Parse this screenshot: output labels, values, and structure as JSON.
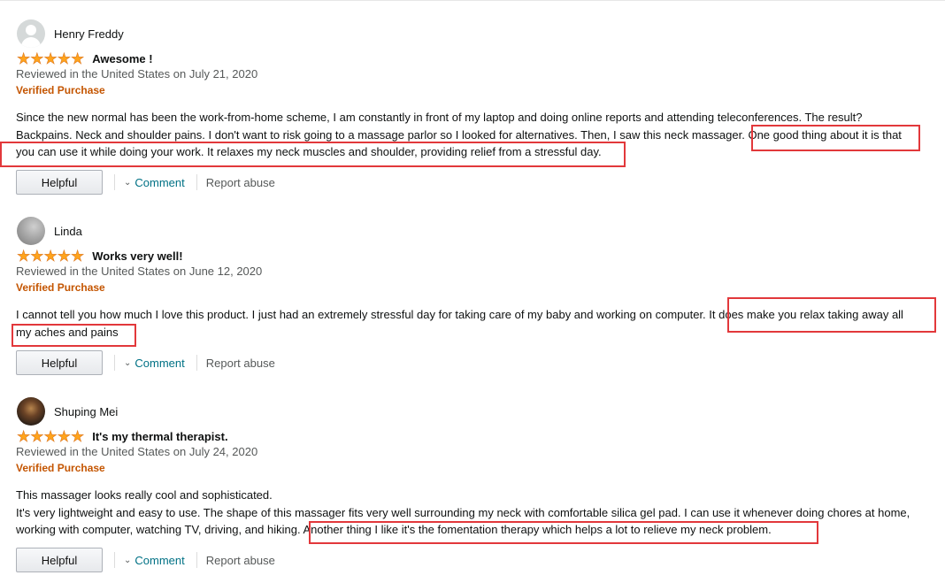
{
  "reviews": [
    {
      "name": "Henry Freddy",
      "avatar_icon": "default-profile-icon",
      "stars": "★★★★★",
      "title": "Awesome !",
      "date": "Reviewed in the United States on July 21, 2020",
      "verified": "Verified Purchase",
      "lines": [
        "Since the new normal has been the work-from-home scheme, I am constantly in front of my laptop and doing online reports and attending teleconferences. The result?",
        "Backpains. Neck and shoulder pains. I don't want to risk going to a massage parlor so I looked for alternatives. Then, I saw this neck massager. One good thing about it is that",
        "you can use it while doing your work. It relaxes my neck muscles and shoulder, providing relief from a stressful day."
      ],
      "helpful": "Helpful",
      "comment": "Comment",
      "report": "Report abuse"
    },
    {
      "name": "Linda",
      "avatar_icon": "profile-photo",
      "stars": "★★★★★",
      "title": "Works very well!",
      "date": "Reviewed in the United States on June 12, 2020",
      "verified": "Verified Purchase",
      "lines": [
        "I cannot tell you how much I love this product. I just had an extremely stressful day for taking care of my baby and working on computer. It does make you relax taking away all",
        "my aches and pains"
      ],
      "helpful": "Helpful",
      "comment": "Comment",
      "report": "Report abuse"
    },
    {
      "name": "Shuping Mei",
      "avatar_icon": "profile-photo",
      "stars": "★★★★★",
      "title": "It's my thermal therapist.",
      "date": "Reviewed in the United States on July 24, 2020",
      "verified": "Verified Purchase",
      "lines": [
        "This massager looks really cool and sophisticated.",
        "It's very lightweight and easy to use. The shape of this massager fits very well surrounding my neck with comfortable silica gel pad. I can use it whenever doing chores at home,",
        "working with computer, watching TV, driving, and hiking. Another thing I like it's the fomentation therapy which helps a lot to relieve my neck problem."
      ],
      "helpful": "Helpful",
      "comment": "Comment",
      "report": "Report abuse"
    }
  ],
  "colors": {
    "star": "#ffa41c",
    "verified": "#c45500",
    "link": "#007185",
    "highlight": "#e2383b"
  }
}
